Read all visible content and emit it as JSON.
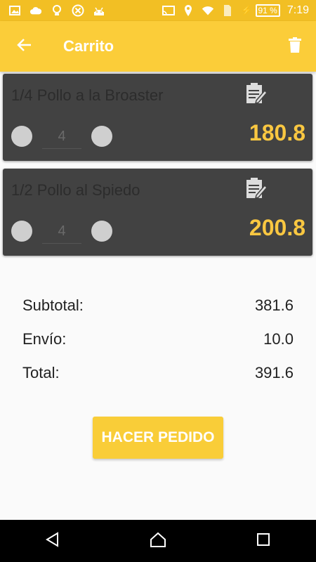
{
  "status_bar": {
    "battery": "91 %",
    "time": "7:19",
    "left_icons": [
      "image-icon",
      "cloud-icon",
      "lightbulb-icon",
      "close-circle-icon",
      "android-icon"
    ],
    "right_icons": [
      "cast-icon",
      "location-icon",
      "wifi-icon",
      "sim-icon",
      "charging-icon"
    ]
  },
  "app_bar": {
    "title": "Carrito",
    "back_icon": "arrow-back-icon",
    "delete_icon": "trash-icon"
  },
  "cart": {
    "items": [
      {
        "name": "1/4 Pollo a la Broaster",
        "quantity": "4",
        "price": "180.8"
      },
      {
        "name": "1/2 Pollo al Spiedo",
        "quantity": "4",
        "price": "200.8"
      }
    ]
  },
  "summary": {
    "subtotal_label": "Subtotal:",
    "subtotal_value": "381.6",
    "shipping_label": "Envío:",
    "shipping_value": "10.0",
    "total_label": "Total:",
    "total_value": "391.6"
  },
  "actions": {
    "order_label": "HACER PEDIDO"
  },
  "colors": {
    "status_bar": "#f2bf24",
    "app_bar": "#fbcd39",
    "card_bg": "#424242",
    "price": "#f9c741",
    "button": "#f9cd38"
  },
  "nav_bar": {
    "icons": [
      "back-triangle-icon",
      "home-icon",
      "recents-icon"
    ]
  }
}
